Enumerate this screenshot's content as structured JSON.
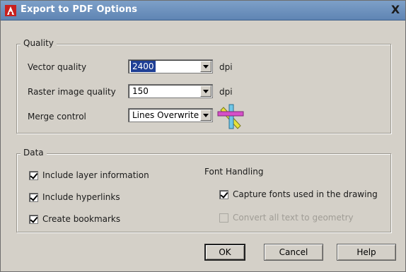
{
  "window": {
    "title": "Export to PDF Options",
    "close_glyph": "X",
    "app_icon": "autocad-logo-icon"
  },
  "quality": {
    "legend": "Quality",
    "vector_quality": {
      "label": "Vector quality",
      "value": "2400",
      "unit": "dpi"
    },
    "raster_quality": {
      "label": "Raster image quality",
      "value": "150",
      "unit": "dpi"
    },
    "merge_control": {
      "label": "Merge control",
      "value": "Lines Overwrite",
      "icon": "merge-lines-preview-icon"
    }
  },
  "data": {
    "legend": "Data",
    "include_layer_info": {
      "label": "Include layer information",
      "checked": true
    },
    "include_hyperlinks": {
      "label": "Include hyperlinks",
      "checked": true
    },
    "create_bookmarks": {
      "label": "Create bookmarks",
      "checked": true
    },
    "font_handling": {
      "heading": "Font Handling",
      "capture_fonts": {
        "label": "Capture fonts used in the drawing",
        "checked": true
      },
      "convert_text": {
        "label": "Convert all text to geometry",
        "checked": false,
        "enabled": false
      }
    }
  },
  "buttons": {
    "ok": "OK",
    "cancel": "Cancel",
    "help": "Help"
  },
  "colors": {
    "titlebar": "#6a8fbd",
    "dialog_bg": "#d4d0c8",
    "selection": "#1f3f95"
  }
}
